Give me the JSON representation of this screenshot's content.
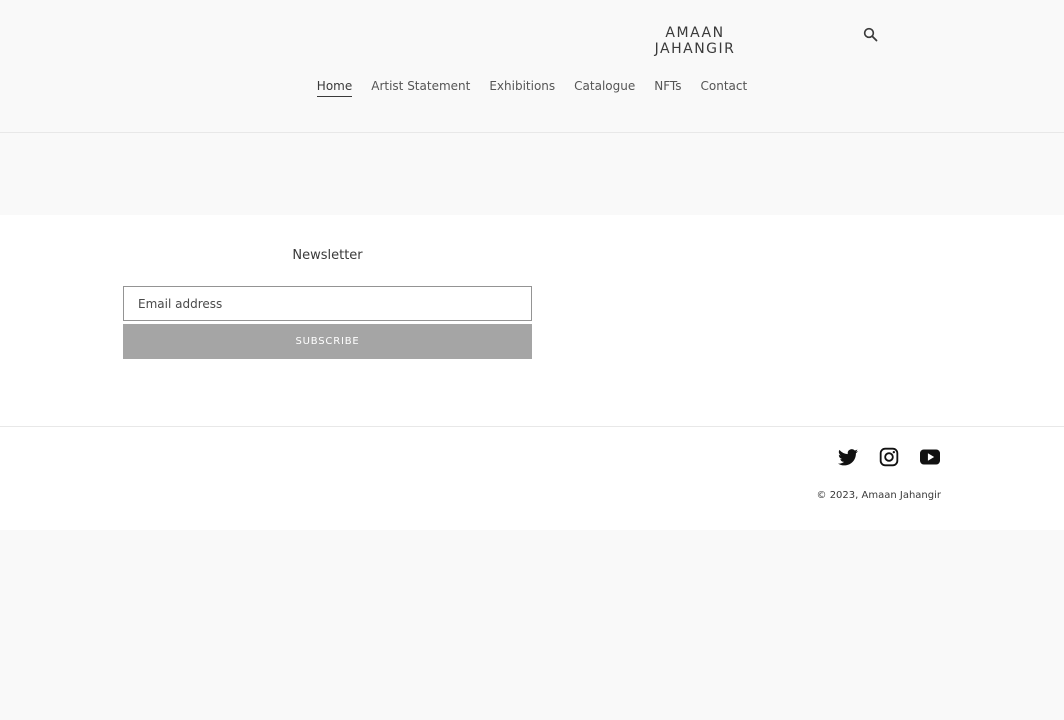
{
  "header": {
    "logo_line1": "AMAAN",
    "logo_line2": "JAHANGIR",
    "search_icon": "search-icon"
  },
  "nav": {
    "items": [
      {
        "label": "Home",
        "active": true
      },
      {
        "label": "Artist Statement",
        "active": false
      },
      {
        "label": "Exhibitions",
        "active": false
      },
      {
        "label": "Catalogue",
        "active": false
      },
      {
        "label": "NFTs",
        "active": false
      },
      {
        "label": "Contact",
        "active": false
      }
    ]
  },
  "newsletter": {
    "title": "Newsletter",
    "email_placeholder": "Email address",
    "email_value": "",
    "subscribe_label": "SUBSCRIBE"
  },
  "footer": {
    "social_icons": [
      "twitter-icon",
      "instagram-icon",
      "youtube-icon"
    ],
    "copyright_prefix": "© 2023, ",
    "copyright_owner": "Amaan Jahangir"
  },
  "colors": {
    "background": "#f9f9f9",
    "panel": "#ffffff",
    "text": "#3a3a3a",
    "button": "#a5a5a5",
    "border": "#e8e8e8"
  }
}
